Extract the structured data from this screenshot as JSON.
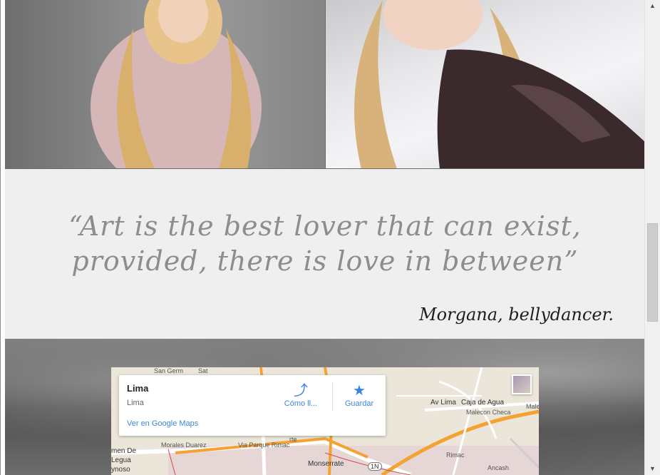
{
  "quote": {
    "text": "“Art is the best lover that can exist, provided, there is love in between”",
    "author": "Morgana, bellydancer."
  },
  "map_card": {
    "title": "Lima",
    "subtitle": "Lima",
    "directions_label": "Cómo ll...",
    "save_label": "Guardar",
    "open_link": "Ver en Google Maps"
  },
  "map_labels": {
    "av_lima": "Av Lima",
    "caja_de_agua": "Caja de Agua",
    "malecon": "Malecon Checa",
    "male": "Male",
    "morales": "Morales Duarez",
    "via_parque": "Via Parque Rimac",
    "monserrate": "Monserrate",
    "route_1n": "1N",
    "men_de": "men De",
    "legua": "Legua",
    "ynoso": "ynoso",
    "ancash": "Ancash",
    "san_germ": "San Germ",
    "sat": "Sat",
    "rte": "rte",
    "rimac": "Rimac"
  },
  "icons": {
    "directions": "directions-icon",
    "save": "star-icon",
    "scroll_up": "scroll-up-arrow-icon",
    "scroll_down": "scroll-down-arrow-icon"
  },
  "colors": {
    "quote": "#8d8d8d",
    "author": "#1e1e1e",
    "link": "#3a84df",
    "road_major": "#f4a233"
  }
}
